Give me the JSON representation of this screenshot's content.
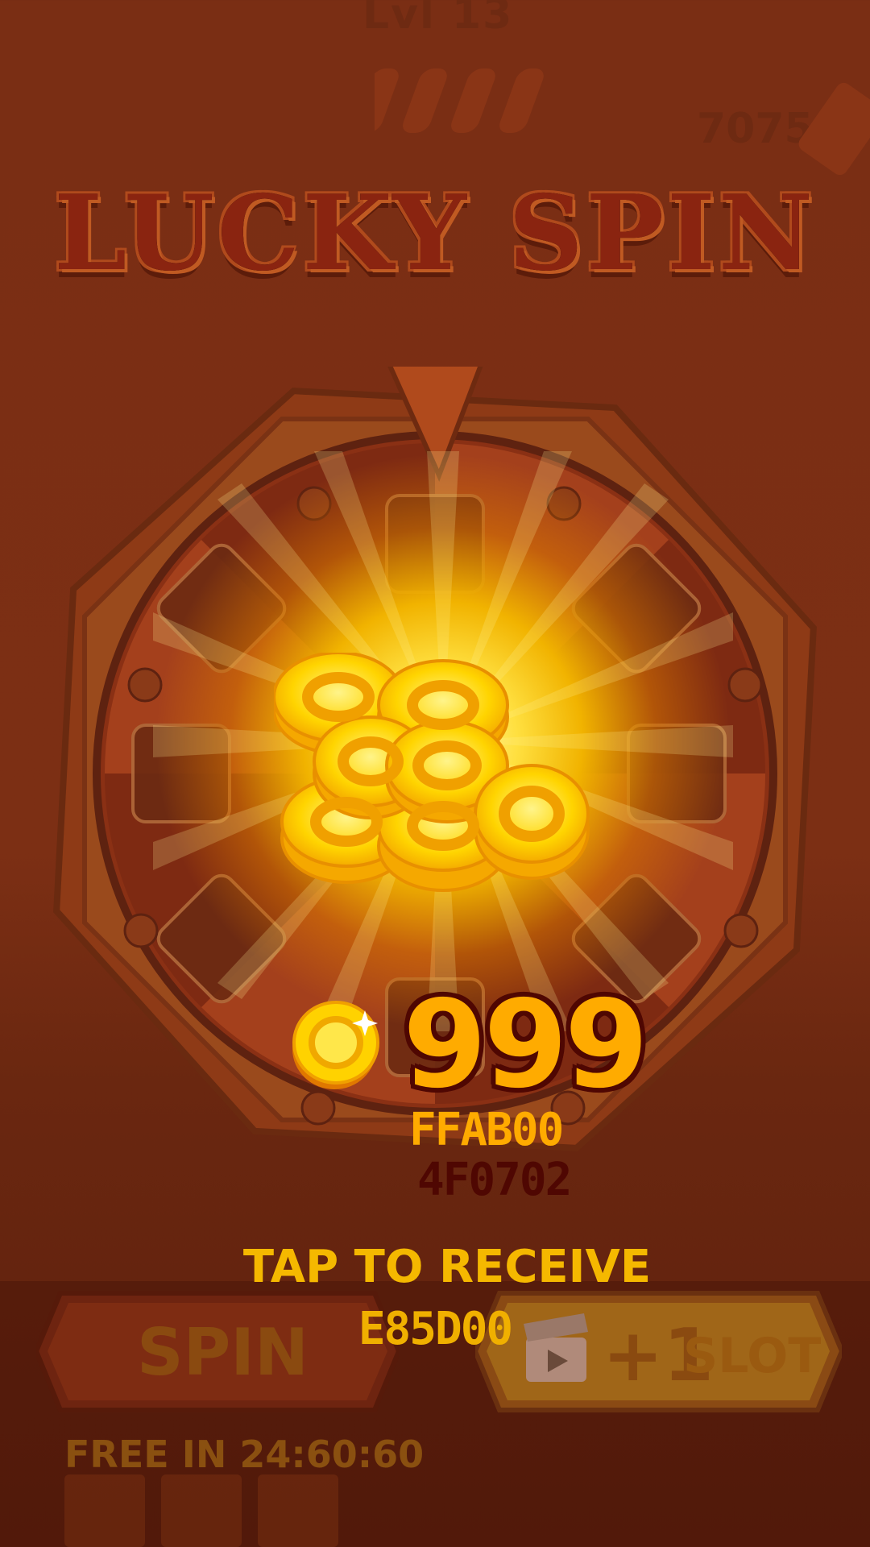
{
  "hud": {
    "level": "Lvl 13",
    "coins": "7075"
  },
  "title": "LUCKY SPIN",
  "reward": {
    "amount": "999",
    "color_primary": "FFAB00",
    "color_outline": "4F0702"
  },
  "prompt": {
    "tap": "TAP TO RECEIVE",
    "tap_color": "E85D00"
  },
  "buttons": {
    "spin": "SPIN",
    "slot_plus": "+1",
    "slot_word": "SLOT"
  },
  "timer": "FREE IN 24:60:60",
  "icons": [
    "coin-pile-icon",
    "pickaxe-icon",
    "wood-stick-icon",
    "coin-icon",
    "clapperboard-icon",
    "gem-icon"
  ]
}
